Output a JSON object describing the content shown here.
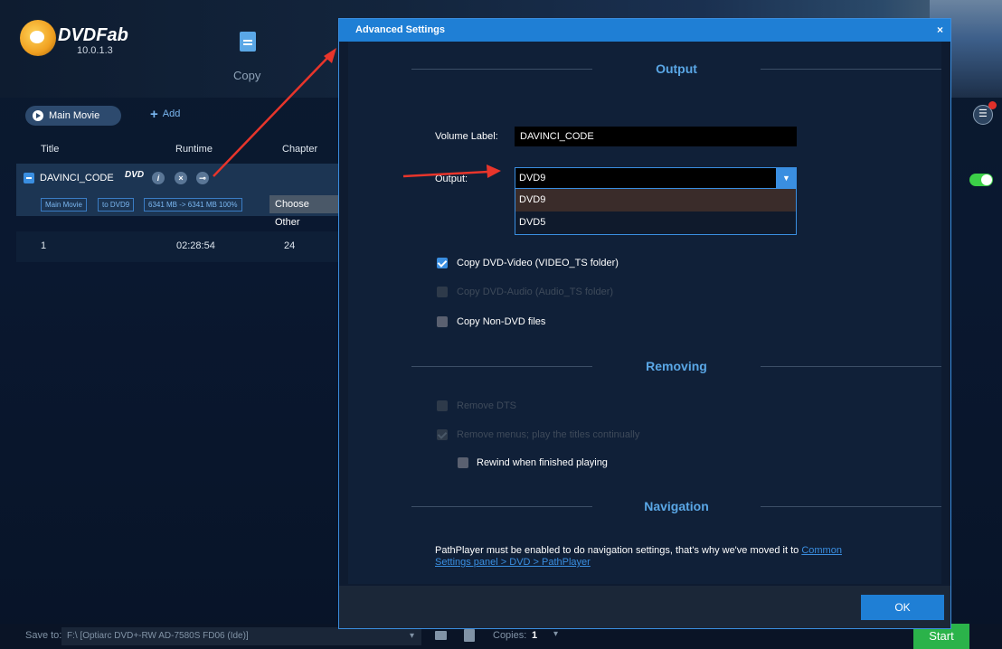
{
  "app": {
    "brand": "DVDFab",
    "version": "10.0.1.3",
    "module_label": "Copy",
    "colors": {
      "accent": "#1f7fd5",
      "start": "#2bb34a",
      "arrow": "#e8352b"
    }
  },
  "window_controls": {
    "minimize": "–",
    "maximize": "□",
    "close": "×"
  },
  "left_panel": {
    "main_movie_label": "Main Movie",
    "add_label": "Add",
    "columns": {
      "title": "Title",
      "runtime": "Runtime",
      "chapter": "Chapter"
    },
    "title_item": {
      "name": "DAVINCI_CODE",
      "dvd_logo": "DVD",
      "info": "i",
      "remove": "×",
      "tags": [
        "Main Movie",
        "to DVD9",
        "6341 MB -> 6341 MB 100%"
      ],
      "choose_other": "Choose Other"
    },
    "row": {
      "title": "1",
      "runtime": "02:28:54",
      "chapter": "24"
    }
  },
  "dialog": {
    "title": "Advanced Settings",
    "close": "×",
    "output_section": "Output",
    "volume_label_text": "Volume Label:",
    "volume_label_value": "DAVINCI_CODE",
    "output_label": "Output:",
    "output_selected": "DVD9",
    "output_options": [
      "DVD9",
      "DVD5"
    ],
    "checkboxes": {
      "copy_dvd_video": "Copy DVD-Video (VIDEO_TS folder)",
      "copy_dvd_audio": "Copy DVD-Audio (Audio_TS folder)",
      "copy_non_dvd": "Copy Non-DVD files"
    },
    "removing_section": "Removing",
    "remove_dts": "Remove DTS",
    "remove_menus": "Remove menus; play the titles continually",
    "rewind": "Rewind when finished playing",
    "navigation_section": "Navigation",
    "nav_text": "PathPlayer must be enabled to do navigation settings, that's why we've moved it to ",
    "nav_link": "Common Settings panel > DVD > PathPlayer",
    "ok": "OK"
  },
  "bottom": {
    "save_to_label": "Save to:",
    "save_path": "F:\\ [Optiarc DVD+-RW AD-7580S FD06 (Ide)]",
    "copies_label": "Copies:",
    "copies_value": "1",
    "start": "Start"
  }
}
